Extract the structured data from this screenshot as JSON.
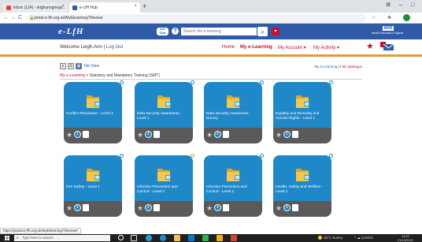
{
  "browser": {
    "tabs": [
      {
        "label": "Inbox (124) - leighanngriego…",
        "icon": "gmail-icon",
        "active": false
      },
      {
        "label": "e-LfH Hub",
        "icon": "elfh-icon",
        "active": true
      }
    ],
    "new_tab": "+",
    "window_controls": {
      "settings": "⚙",
      "minimize": "–",
      "maximize": "□"
    },
    "nav": {
      "back": "←",
      "forward": "→",
      "reload": "C"
    },
    "url": "portal.e-lfh.org.uk/MyElearning/Tileview"
  },
  "site": {
    "logo": "e-LfH",
    "live_chat": "Live Chat",
    "help": "?",
    "search_placeholder": "Search the e-learning",
    "nhs_logo": "NHS",
    "hee_text": "Health Education England",
    "welcome": "Welcome Leigh-Ann",
    "logout": "Log Out",
    "nav": [
      {
        "label": "Home"
      },
      {
        "label": "My e-Learning",
        "bold": true
      },
      {
        "label": "My Account ▾"
      },
      {
        "label": "My Activity ▾"
      }
    ]
  },
  "content": {
    "view_label": "Tile View",
    "my_elearning_link": "My e-Learning",
    "full_catalogue_link": "Full catalogue",
    "breadcrumb_root": "My e-Learning",
    "breadcrumb_sep": ">",
    "breadcrumb_current": "Statutory and Mandatory Training (SMT)",
    "tiles": [
      {
        "name": "Conflict Resolution - Level 1",
        "status": "complete"
      },
      {
        "name": "Data Security Awareness - Level 1",
        "status": "complete"
      },
      {
        "name": "Data Security Awareness Survey",
        "status": "complete"
      },
      {
        "name": "Equality and Diversity and Human Rights - Level 1",
        "status": "complete"
      },
      {
        "name": "Fire Safety - Level 1",
        "status": "complete"
      },
      {
        "name": "Infection Prevention and Control - Level 1",
        "status": "in-progress"
      },
      {
        "name": "Infection Prevention and Control - Level 2",
        "status": "complete"
      },
      {
        "name": "Health, Safety and Welfare - Level 1",
        "status": "complete"
      }
    ]
  },
  "status_url": "https://portal.e-lfh.org.uk/MyElearning/Tileview#",
  "taskbar": {
    "search_placeholder": "Type here to search",
    "weather": "15°C Sunny",
    "tray": "^ ☁ ⊡ ENG",
    "time": "11:02",
    "date": "21/10/2021"
  }
}
